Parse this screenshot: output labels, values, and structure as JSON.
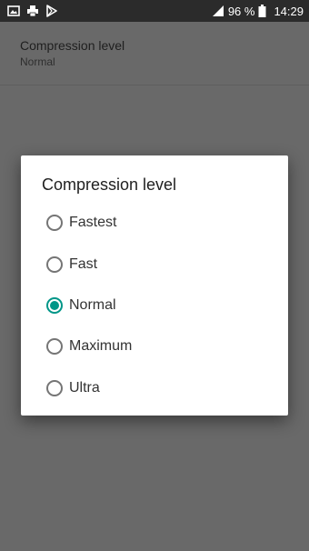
{
  "status_bar": {
    "left_icons": [
      "image-icon",
      "printer-icon",
      "play-store-icon"
    ],
    "battery_percent": "96 %",
    "time": "14:29"
  },
  "preference": {
    "title": "Compression level",
    "summary": "Normal"
  },
  "dialog": {
    "title": "Compression level",
    "options": [
      {
        "label": "Fastest",
        "checked": false
      },
      {
        "label": "Fast",
        "checked": false
      },
      {
        "label": "Normal",
        "checked": true
      },
      {
        "label": "Maximum",
        "checked": false
      },
      {
        "label": "Ultra",
        "checked": false
      }
    ]
  },
  "colors": {
    "accent": "#009688",
    "scrim": "#6e6e6e",
    "status_bar": "#2b2b2b"
  }
}
